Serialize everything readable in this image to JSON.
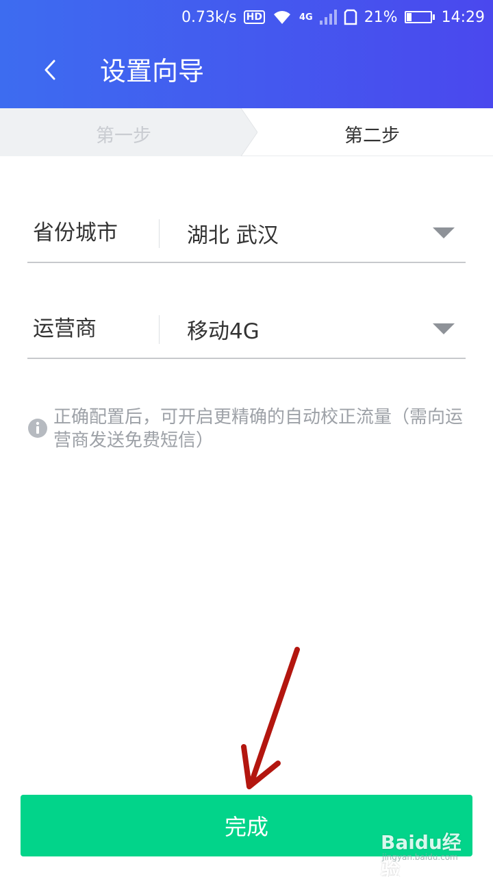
{
  "status_bar": {
    "net_speed": "0.73k/s",
    "hd_label": "HD",
    "network_type": "4G",
    "sim_icon": "!",
    "battery_percent": "21%",
    "battery_level": 0.21,
    "time": "14:29"
  },
  "header": {
    "title": "设置向导",
    "back_icon": "chevron-left-icon"
  },
  "steps": {
    "step1": "第一步",
    "step2": "第二步",
    "active_step": 2
  },
  "form": {
    "province_city": {
      "label": "省份城市",
      "value": "湖北 武汉"
    },
    "carrier": {
      "label": "运营商",
      "value": "移动4G"
    }
  },
  "hint": {
    "icon": "info-icon",
    "text": "正确配置后，可开启更精确的自动校正流量（需向运营商发送免费短信）"
  },
  "done_button": {
    "label": "完成"
  },
  "watermark": {
    "main": "Baidu经验",
    "sub": "jingyan.baidu.com"
  },
  "colors": {
    "header_start": "#3d6cf0",
    "header_end": "#4a48ee",
    "primary_button": "#02d48a",
    "annotation_arrow": "#b3160f"
  }
}
